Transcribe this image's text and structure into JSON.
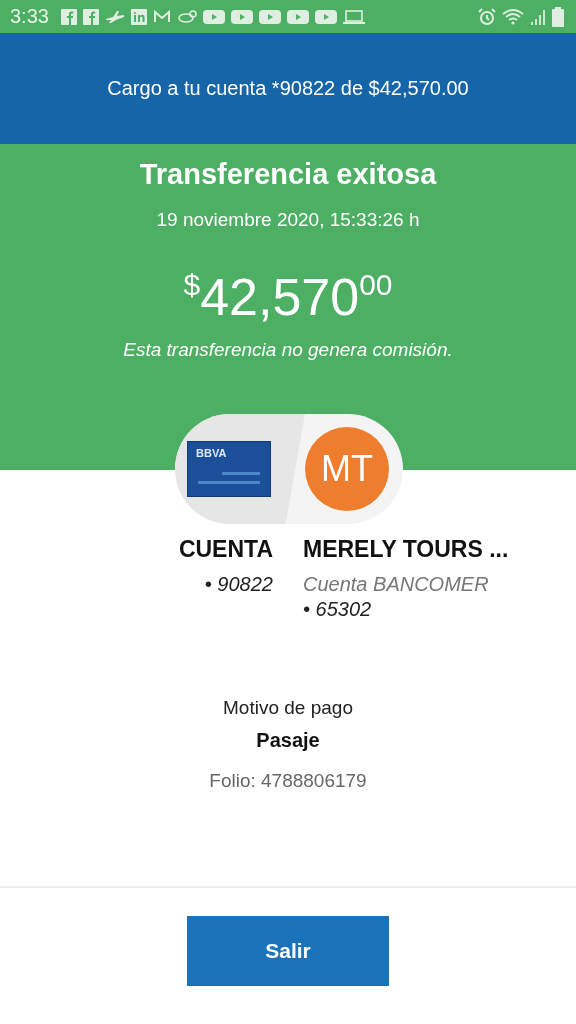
{
  "status_bar": {
    "time": "3:33",
    "notification_icons": [
      {
        "kind": "facebook"
      },
      {
        "kind": "facebook"
      },
      {
        "kind": "plane"
      },
      {
        "kind": "linkedin"
      },
      {
        "kind": "mail"
      },
      {
        "kind": "bird"
      },
      {
        "kind": "play"
      },
      {
        "kind": "play"
      },
      {
        "kind": "play"
      },
      {
        "kind": "play"
      },
      {
        "kind": "play"
      },
      {
        "kind": "laptop"
      }
    ]
  },
  "header": {
    "title": "Cargo a tu cuenta *90822 de $42,570.00"
  },
  "result": {
    "title": "Transferencia exitosa",
    "datetime": "19 noviembre 2020, 15:33:26 h",
    "currency": "$",
    "amount": "42,570",
    "cents": "00",
    "note": "Esta transferencia no genera comisión."
  },
  "origin": {
    "card_label": "BBVA",
    "name": "CUENTA",
    "account": "• 90822"
  },
  "destination": {
    "initials": "MT",
    "name": "MERELY TOURS ...",
    "bank": "Cuenta BANCOMER",
    "account": "• 65302"
  },
  "details": {
    "label": "Motivo de pago",
    "value": "Pasaje",
    "folio": "Folio: 4788806179"
  },
  "button": {
    "label": "Salir"
  }
}
